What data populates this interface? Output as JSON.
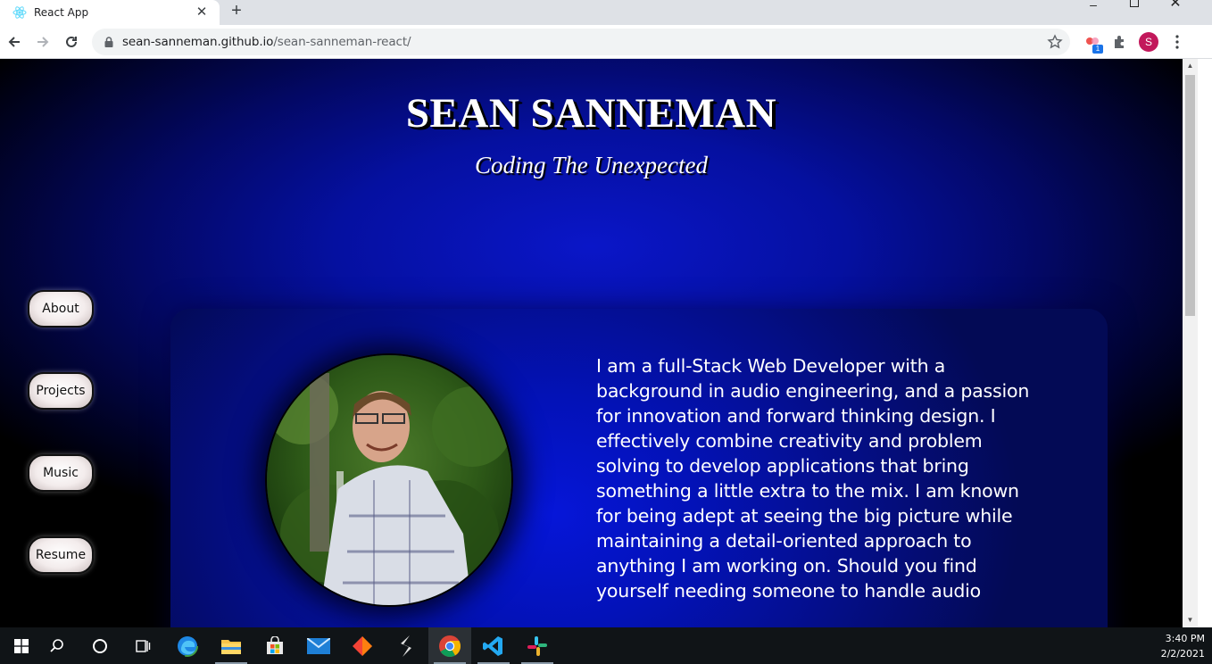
{
  "browser": {
    "tab_title": "React App",
    "url_host": "sean-sanneman.github.io",
    "url_path": "/sean-sanneman-react/",
    "extension_badge": "1",
    "profile_initial": "S"
  },
  "site": {
    "title": "SEAN SANNEMAN",
    "subtitle": "Coding The Unexpected",
    "nav": [
      {
        "label": "About"
      },
      {
        "label": "Projects"
      },
      {
        "label": "Music"
      },
      {
        "label": "Resume"
      }
    ],
    "bio": "I am a full-Stack Web Developer with a background in audio engineering, and a passion for innovation and forward thinking design. I effectively combine creativity and problem solving to develop applications that bring something a little extra to the mix. I am known for being adept at seeing the big picture while maintaining a detail-oriented approach to anything I am working on. Should you find yourself needing someone to handle audio"
  },
  "taskbar": {
    "time": "3:40 PM",
    "date": "2/2/2021",
    "apps": [
      "start-icon",
      "search-icon",
      "cortana-icon",
      "task-view-icon",
      "edge-icon",
      "file-explorer-icon",
      "store-icon",
      "mail-icon",
      "git-kraken-icon",
      "sublime-icon",
      "chrome-icon",
      "vscode-icon",
      "slack-icon"
    ]
  },
  "colors": {
    "page_bg_center": "#0a16c8",
    "card_bg": "#0312b8",
    "button_face": "#f3ecec"
  }
}
